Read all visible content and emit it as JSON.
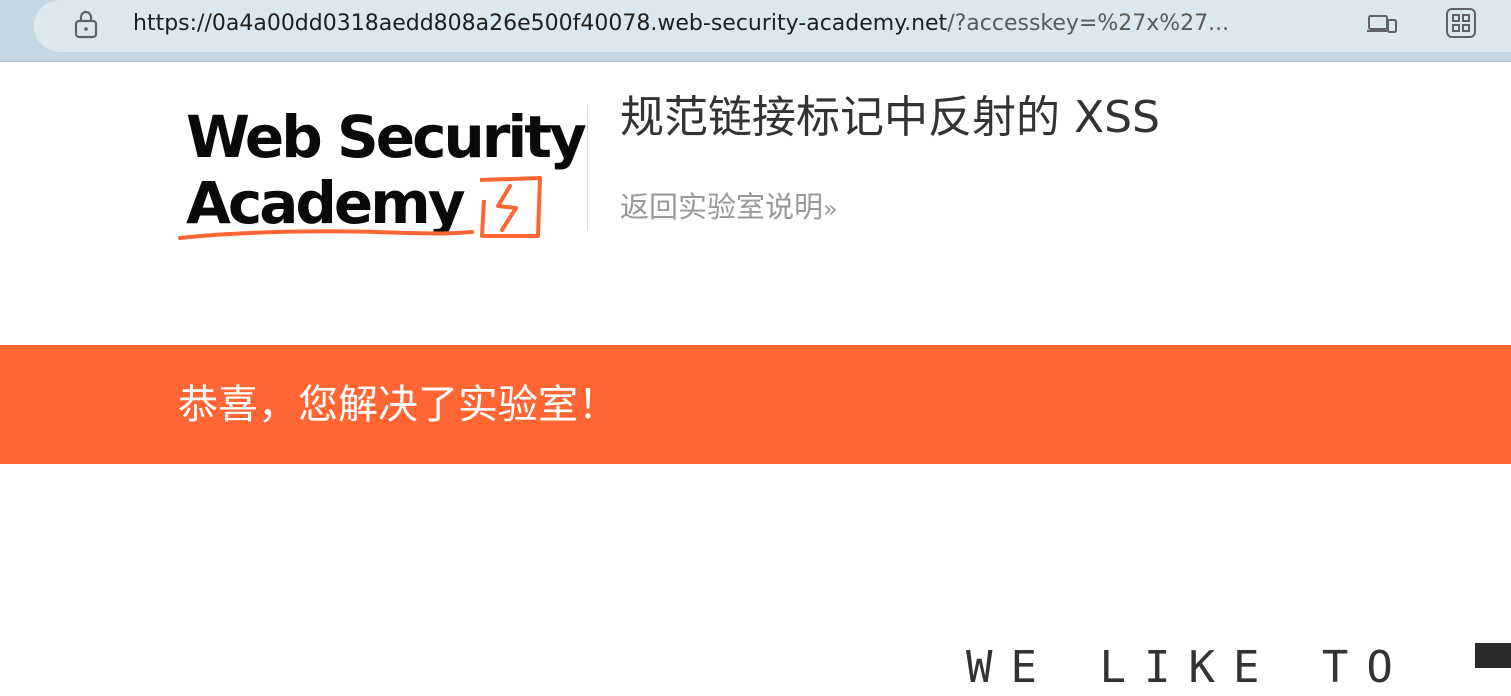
{
  "browser": {
    "url_host": "https://0a4a00dd0318aedd808a26e500f40078.web-security-academy.net",
    "url_rest": "/?accesskey=%27x%27...",
    "lock_icon": "lock-icon",
    "devices_icon": "devices-icon",
    "apps_icon": "apps-grid-icon"
  },
  "header": {
    "logo_line1": "Web Security",
    "logo_line2": "Academy",
    "lab_title": "规范链接标记中反射的 XSS",
    "back_link_label": "返回实验室说明",
    "back_link_chevron": "»"
  },
  "banner": {
    "message": "恭喜，您解决了实验室！"
  },
  "footer": {
    "tagline": "WE LIKE TO"
  },
  "colors": {
    "accent": "#ff6633",
    "title_text": "#333333",
    "link_text": "#999999",
    "addressbar_bg": "#dbe8ef",
    "browser_frame": "#c5d9e5"
  }
}
